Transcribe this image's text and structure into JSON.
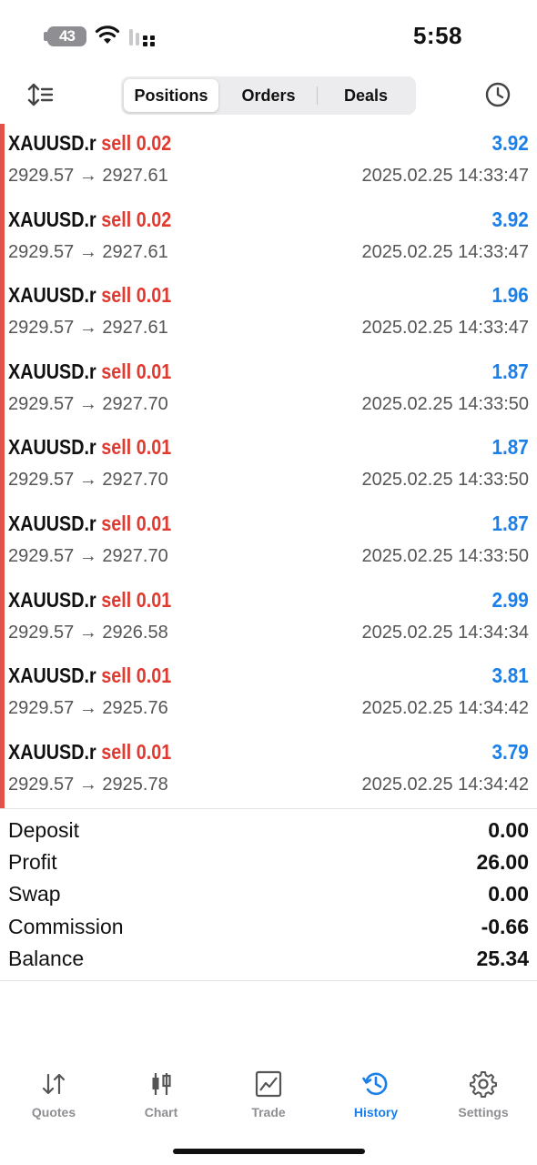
{
  "status_bar": {
    "time": "5:58",
    "battery": "43"
  },
  "tabs_top": {
    "items": [
      "Positions",
      "Orders",
      "Deals"
    ],
    "active": 0
  },
  "positions": [
    {
      "symbol": "XAUUSD.r",
      "side": "sell 0.02",
      "profit": "3.92",
      "prices": "2929.57 → 2927.61",
      "time": "2025.02.25 14:33:47"
    },
    {
      "symbol": "XAUUSD.r",
      "side": "sell 0.02",
      "profit": "3.92",
      "prices": "2929.57 → 2927.61",
      "time": "2025.02.25 14:33:47"
    },
    {
      "symbol": "XAUUSD.r",
      "side": "sell 0.01",
      "profit": "1.96",
      "prices": "2929.57 → 2927.61",
      "time": "2025.02.25 14:33:47"
    },
    {
      "symbol": "XAUUSD.r",
      "side": "sell 0.01",
      "profit": "1.87",
      "prices": "2929.57 → 2927.70",
      "time": "2025.02.25 14:33:50"
    },
    {
      "symbol": "XAUUSD.r",
      "side": "sell 0.01",
      "profit": "1.87",
      "prices": "2929.57 → 2927.70",
      "time": "2025.02.25 14:33:50"
    },
    {
      "symbol": "XAUUSD.r",
      "side": "sell 0.01",
      "profit": "1.87",
      "prices": "2929.57 → 2927.70",
      "time": "2025.02.25 14:33:50"
    },
    {
      "symbol": "XAUUSD.r",
      "side": "sell 0.01",
      "profit": "2.99",
      "prices": "2929.57 → 2926.58",
      "time": "2025.02.25 14:34:34"
    },
    {
      "symbol": "XAUUSD.r",
      "side": "sell 0.01",
      "profit": "3.81",
      "prices": "2929.57 → 2925.76",
      "time": "2025.02.25 14:34:42"
    },
    {
      "symbol": "XAUUSD.r",
      "side": "sell 0.01",
      "profit": "3.79",
      "prices": "2929.57 → 2925.78",
      "time": "2025.02.25 14:34:42"
    }
  ],
  "summary": [
    {
      "label": "Deposit",
      "value": "0.00"
    },
    {
      "label": "Profit",
      "value": "26.00"
    },
    {
      "label": "Swap",
      "value": "0.00"
    },
    {
      "label": "Commission",
      "value": "-0.66"
    },
    {
      "label": "Balance",
      "value": "25.34"
    }
  ],
  "bottom_tabs": [
    {
      "label": "Quotes",
      "icon": "quotes-arrows-icon"
    },
    {
      "label": "Chart",
      "icon": "candlestick-icon"
    },
    {
      "label": "Trade",
      "icon": "trade-chart-icon"
    },
    {
      "label": "History",
      "icon": "history-clock-icon"
    },
    {
      "label": "Settings",
      "icon": "gear-icon"
    }
  ],
  "bottom_tabs_active": 3,
  "colors": {
    "accent": "#1a7fe8",
    "sell": "#e0392f",
    "side_bar": "#e0524a",
    "muted": "#8e8e93"
  }
}
